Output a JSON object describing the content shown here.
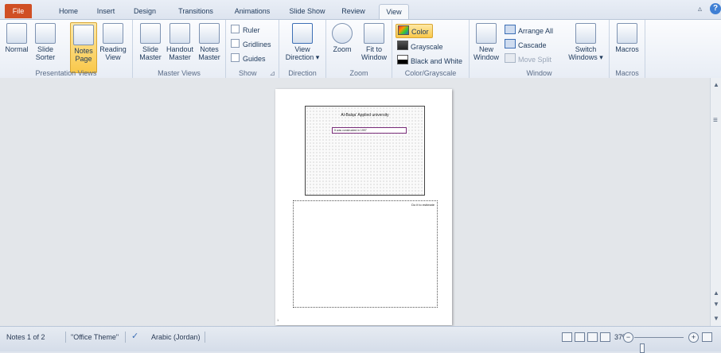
{
  "tabs": [
    "File",
    "Home",
    "Insert",
    "Design",
    "Transitions",
    "Animations",
    "Slide Show",
    "Review",
    "View"
  ],
  "help_icon": "help-icon",
  "ribbon": {
    "presentation_views": {
      "label": "Presentation Views",
      "buttons": [
        {
          "line1": "Normal",
          "line2": ""
        },
        {
          "line1": "Slide",
          "line2": "Sorter"
        },
        {
          "line1": "Notes",
          "line2": "Page"
        },
        {
          "line1": "Reading",
          "line2": "View"
        }
      ]
    },
    "master_views": {
      "label": "Master Views",
      "buttons": [
        {
          "line1": "Slide",
          "line2": "Master"
        },
        {
          "line1": "Handout",
          "line2": "Master"
        },
        {
          "line1": "Notes",
          "line2": "Master"
        }
      ]
    },
    "show": {
      "label": "Show",
      "ruler": "Ruler",
      "gridlines": "Gridlines",
      "guides": "Guides"
    },
    "direction": {
      "label": "Direction",
      "line1": "View",
      "line2": "Direction ▾"
    },
    "zoom": {
      "label": "Zoom",
      "zoom": "Zoom",
      "fit_line1": "Fit to",
      "fit_line2": "Window"
    },
    "color": {
      "label": "Color/Grayscale",
      "color": "Color",
      "grayscale": "Grayscale",
      "bw": "Black and White"
    },
    "window": {
      "label": "Window",
      "new_line1": "New",
      "new_line2": "Window",
      "arrange_all": "Arrange All",
      "cascade": "Cascade",
      "move_split": "Move Split",
      "switch_line1": "Switch",
      "switch_line2": "Windows ▾"
    },
    "macros": {
      "label": "Macros",
      "button": "Macros"
    }
  },
  "slide": {
    "title": "Al-Balqa' Applied university",
    "subtitle": "It was constructed in 1997",
    "notes_placeholder": "Do it to estimate"
  },
  "status": {
    "notes": "Notes 1 of 2",
    "theme": "\"Office Theme\"",
    "language": "Arabic (Jordan)",
    "zoom": "37%",
    "zoom_fraction": 0.37
  },
  "colors": {
    "file_tab": "#d04f24",
    "selected": "#f9c84a"
  }
}
